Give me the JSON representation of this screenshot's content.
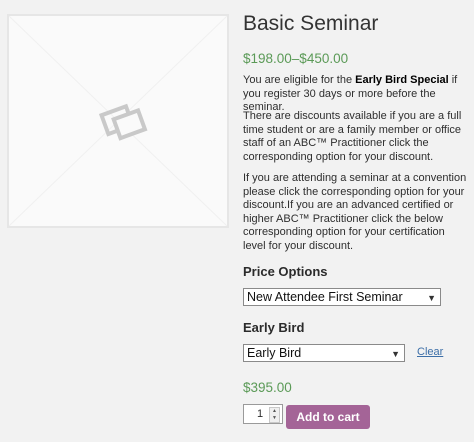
{
  "product": {
    "title": "Basic Seminar",
    "price_range": "$198.00–$450.00",
    "image_icon": "placeholder-image-icon"
  },
  "description": {
    "p1_before": "You are eligible for the ",
    "p1_bold": "Early Bird Special",
    "p1_after": " if you register 30 days or more before the seminar.",
    "p2": "There are discounts available if you are a full time student or are a family member or office staff of an ABC™ Practitioner click the corresponding option for your discount.",
    "p3": "If you are attending a seminar at a convention please click the corresponding option for your discount.If you are an advanced certified or higher ABC™ Practitioner click the below corresponding option for your certification level for your discount."
  },
  "variations": {
    "price_options_label": "Price Options",
    "price_options_value": "New Attendee First Seminar",
    "early_bird_label": "Early Bird",
    "early_bird_value": "Early Bird",
    "clear_label": "Clear"
  },
  "cart": {
    "variation_price": "$395.00",
    "quantity": "1",
    "add_to_cart_label": "Add to cart"
  },
  "colors": {
    "price_green": "#5b9a57",
    "button_purple": "#a46497",
    "link_blue": "#3d6fa8"
  }
}
